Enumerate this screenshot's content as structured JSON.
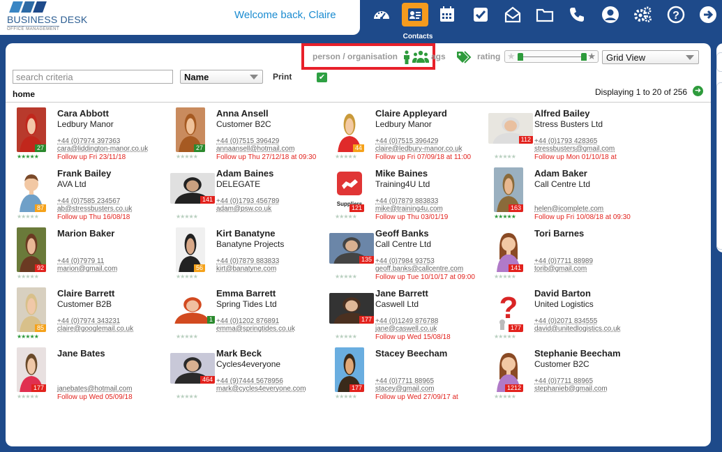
{
  "app": {
    "logo_title": "BUSINESS DESK",
    "logo_subtitle": "OFFICE MANAGEMENT",
    "welcome": "Welcome back, Claire"
  },
  "nav": {
    "active_label": "Contacts",
    "items": [
      "dashboard-icon",
      "contacts-icon",
      "calendar-icon",
      "tasks-icon",
      "mail-icon",
      "folder-icon",
      "phone-icon",
      "user-icon",
      "settings-icon",
      "help-icon",
      "logout-icon"
    ]
  },
  "filters": {
    "person_org_label": "person / organisation",
    "tags_label": "ags",
    "rating_label": "rating",
    "view_select": "Grid View",
    "search_placeholder": "search criteria",
    "sort_select": "Name",
    "print_label": "Print",
    "print_checked": true,
    "rating_range": [
      1,
      5
    ]
  },
  "breadcrumb": "home",
  "displaying": "Displaying 1 to 20 of 256",
  "colors": {
    "header_bg": "#1e4a8a",
    "accent_orange": "#f59b1e",
    "green": "#2e9b3c",
    "red": "#e2221d",
    "highlight_box": "#e8202a"
  },
  "contacts": [
    {
      "name": "Cara Abbott",
      "org": "Ledbury Manor",
      "phone": "+44 (0)7974 397363",
      "email": "cara@liddington-manor.co.uk",
      "followup": "Follow up Fri 23/11/18",
      "badge": "27",
      "badge_color": "green",
      "stars": "★★★★★",
      "stars_on": true
    },
    {
      "name": "Anna Ansell",
      "org": "Customer B2C",
      "phone": "+44 (0)7515 396429",
      "email": "annaansell@hotmail.com",
      "followup": "Follow up Thu 27/12/18 at 09:30",
      "badge": "27",
      "badge_color": "green",
      "stars": "★★★★★",
      "stars_on": false
    },
    {
      "name": "Claire Appleyard",
      "org": "Ledbury Manor",
      "phone": "+44 (0)7515 396429",
      "email": "claire@ledbury-manor.co.uk",
      "followup": "Follow up Fri 07/09/18 at 11:00",
      "badge": "44",
      "badge_color": "orange",
      "stars": "★★★★★",
      "stars_on": false
    },
    {
      "name": "Alfred Bailey",
      "org": "Stress Busters Ltd",
      "phone": "+44 (0)1793 428365",
      "email": "stressbusters@gmail.com",
      "followup": "Follow up Mon 01/10/18 at",
      "badge": "112",
      "badge_color": "red",
      "stars": "★★★★★",
      "stars_on": false
    },
    {
      "name": "Frank Bailey",
      "org": "AVA Ltd",
      "phone": "+44 (0)7585 234567",
      "email": "ab@stressbusters.co.uk",
      "followup": "Follow up Thu 16/08/18",
      "badge": "87",
      "badge_color": "orange",
      "stars": "★★★★★",
      "stars_on": false
    },
    {
      "name": "Adam Baines",
      "org": "DELEGATE",
      "phone": "+44 (0)1793 456789",
      "email": "adam@psw.co.uk",
      "followup": "",
      "badge": "141",
      "badge_color": "red",
      "stars": "★★★★★",
      "stars_on": false
    },
    {
      "name": "Mike Baines",
      "org": "Training4U Ltd",
      "phone": "+44 (0)7879 883833",
      "email": "mike@training4u.com",
      "followup": "Follow up Thu 03/01/19",
      "badge": "121",
      "badge_color": "red",
      "stars": "★★★★★",
      "stars_on": false
    },
    {
      "name": "Adam Baker",
      "org": "Call Centre Ltd",
      "phone": "",
      "email": "helen@icomplete.com",
      "followup": "Follow up Fri 10/08/18 at 09:30",
      "badge": "163",
      "badge_color": "red",
      "stars": "★★★★★",
      "stars_on": true
    },
    {
      "name": "Marion Baker",
      "org": "",
      "phone": "+44 (0)7979 11",
      "email": "marion@gmail.com",
      "followup": "",
      "badge": "92",
      "badge_color": "red",
      "stars": "★★★★★",
      "stars_on": false
    },
    {
      "name": "Kirt Banatyne",
      "org": "Banatyne Projects",
      "phone": "+44 (0)7879 883833",
      "email": "kirt@banatyne.com",
      "followup": "",
      "badge": "56",
      "badge_color": "orange",
      "stars": "★★★★★",
      "stars_on": false
    },
    {
      "name": "Geoff Banks",
      "org": "Call Centre Ltd",
      "phone": "+44 (0)7984 93753",
      "email": "geoff.banks@callcentre.com",
      "followup": "Follow up Tue 10/10/17 at 09:00",
      "badge": "135",
      "badge_color": "red",
      "stars": "★★★★★",
      "stars_on": false
    },
    {
      "name": "Tori Barnes",
      "org": "",
      "phone": "+44 (0)7711 88989",
      "email": "torib@gmail.com",
      "followup": "",
      "badge": "141",
      "badge_color": "red",
      "stars": "★★★★★",
      "stars_on": false
    },
    {
      "name": "Claire Barrett",
      "org": "Customer B2B",
      "phone": "+44 (0)7974 343231",
      "email": "claire@googlemail.co.uk",
      "followup": "",
      "badge": "85",
      "badge_color": "orange",
      "stars": "★★★★★",
      "stars_on": true
    },
    {
      "name": "Emma Barrett",
      "org": "Spring Tides Ltd",
      "phone": "+44 (0)1202 876891",
      "email": "emma@springtides.co.uk",
      "followup": "",
      "badge": "1",
      "badge_color": "green",
      "stars": "★★★★★",
      "stars_on": false
    },
    {
      "name": "Jane Barrett",
      "org": "Caswell Ltd",
      "phone": "+44 (0)1249 876788",
      "email": "jane@caswell.co.uk",
      "followup": "Follow up Wed 15/08/18",
      "badge": "177",
      "badge_color": "red",
      "stars": "★★★★★",
      "stars_on": false
    },
    {
      "name": "David Barton",
      "org": "United Logistics",
      "phone": "+44 (0)2071 834555",
      "email": "david@unitedlogistics.co.uk",
      "followup": "",
      "badge": "177",
      "badge_color": "red",
      "stars": "★★★★★",
      "stars_on": false
    },
    {
      "name": "Jane Bates",
      "org": "",
      "phone": "",
      "email": "janebates@hotmail.com",
      "followup": "Follow up Wed 05/09/18",
      "badge": "177",
      "badge_color": "red",
      "stars": "★★★★★",
      "stars_on": false
    },
    {
      "name": "Mark Beck",
      "org": "Cycles4everyone",
      "phone": "+44 (9)7444 5678956",
      "email": "mark@cycles4everyone.com",
      "followup": "",
      "badge": "464",
      "badge_color": "red",
      "stars": "★★★★★",
      "stars_on": false
    },
    {
      "name": "Stacey Beecham",
      "org": "",
      "phone": "+44 (0)7711 88965",
      "email": "stacey@gmail.com",
      "followup": "Follow up Wed 27/09/17 at",
      "badge": "177",
      "badge_color": "red",
      "stars": "★★★★★",
      "stars_on": false
    },
    {
      "name": "Stephanie Beecham",
      "org": "Customer B2C",
      "phone": "+44 (0)7711 88965",
      "email": "stephanieb@gmail.com",
      "followup": "",
      "badge": "1212",
      "badge_color": "red",
      "stars": "★★★★★",
      "stars_on": false
    }
  ],
  "avatars": [
    {
      "kind": "photo",
      "bg": "#b83a2c",
      "hair": "#c1271c",
      "skin": "#f2c6a8"
    },
    {
      "kind": "photo",
      "bg": "#c98b5e",
      "hair": "#a65a22",
      "skin": "#f0c29a"
    },
    {
      "kind": "photo",
      "bg": "#ffffff",
      "hair": "#c99a3a",
      "skin": "#f3caa3",
      "shirt": "#e02a2a"
    },
    {
      "kind": "photo-wide",
      "bg": "#e8e6e0",
      "hair": "#ddd",
      "skin": "#e9c0a0"
    },
    {
      "kind": "cartoon-m",
      "bg": "#ffffff",
      "hair": "#7a4a2a",
      "skin": "#f2c8a4",
      "shirt": "#6fa0c8"
    },
    {
      "kind": "photo-wide",
      "bg": "#e0e0e0",
      "hair": "#222",
      "skin": "#c9a080"
    },
    {
      "kind": "suppliers",
      "bg": "#e03535",
      "label": "Suppliers"
    },
    {
      "kind": "photo",
      "bg": "#9ab0c0",
      "hair": "#8a6a3a",
      "skin": "#e8b890"
    },
    {
      "kind": "photo",
      "bg": "#6a7a3a",
      "hair": "#6b3a22",
      "skin": "#e8b896"
    },
    {
      "kind": "photo",
      "bg": "#f0f0f0",
      "hair": "#222",
      "skin": "#d8a888"
    },
    {
      "kind": "photo-wide",
      "bg": "#6b86a8",
      "hair": "#444",
      "skin": "#d9b090"
    },
    {
      "kind": "cartoon-f",
      "bg": "#ffffff",
      "hair": "#8a4a24",
      "skin": "#f2c8a4",
      "shirt": "#b07ac8"
    },
    {
      "kind": "photo",
      "bg": "#d8d0c0",
      "hair": "#d8c08a",
      "skin": "#f0c8a8"
    },
    {
      "kind": "photo-wide",
      "bg": "#ffffff",
      "hair": "#d24a20",
      "skin": "#f0c0a0"
    },
    {
      "kind": "photo-wide",
      "bg": "#333",
      "hair": "#4a3020",
      "skin": "#e0b898"
    },
    {
      "kind": "question",
      "bg": "#ffffff"
    },
    {
      "kind": "photo",
      "bg": "#e8e0e0",
      "hair": "#6a4a2a",
      "skin": "#f0c8a8",
      "shirt": "#e03050"
    },
    {
      "kind": "photo-wide",
      "bg": "#c8c8d8",
      "hair": "#2a2a2a",
      "skin": "#d8b090"
    },
    {
      "kind": "photo",
      "bg": "#6aaee0",
      "hair": "#3a2a1a",
      "skin": "#e0a878"
    },
    {
      "kind": "cartoon-f",
      "bg": "#ffffff",
      "hair": "#8a4a24",
      "skin": "#f2c8a4",
      "shirt": "#b07ac8"
    }
  ]
}
